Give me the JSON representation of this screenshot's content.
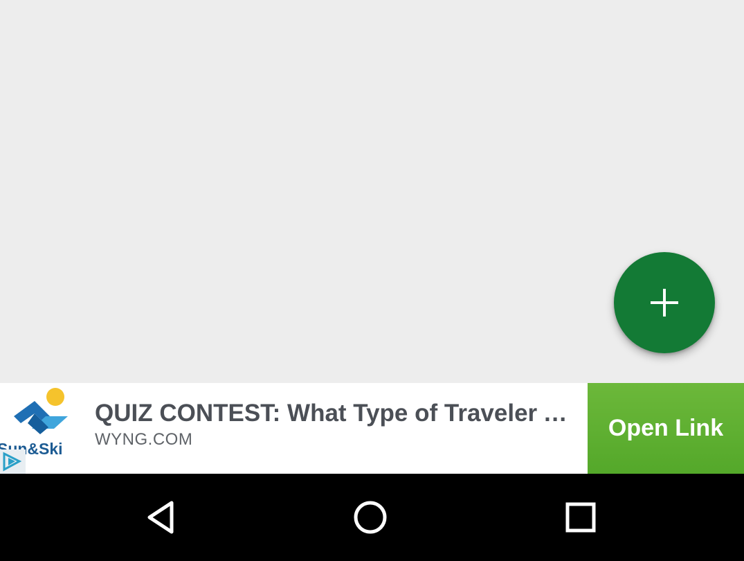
{
  "fab": {
    "icon": "plus-icon",
    "color": "#137a35"
  },
  "ad": {
    "logo_icon": "sun-and-ski-logo",
    "logo_text": "Sun&Ski",
    "title": "QUIZ CONTEST: What Type of Traveler Are You?",
    "domain": "WYNG.COM",
    "button_label": "Open Link",
    "button_color": "#5ab030",
    "adchoices_icon": "adchoices-icon"
  },
  "nav_bar": {
    "back_icon": "back-triangle-icon",
    "home_icon": "home-circle-icon",
    "recents_icon": "recents-square-icon"
  }
}
